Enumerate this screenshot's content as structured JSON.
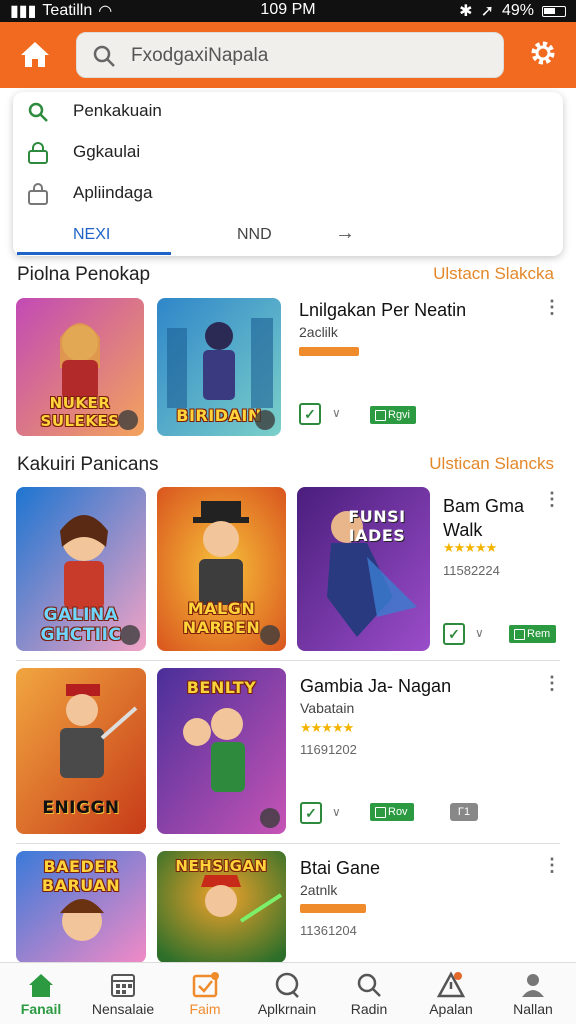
{
  "status_bar": {
    "carrier": "Teatilln",
    "time": "109 PM",
    "battery": "49%"
  },
  "search": {
    "value": "FxodgaxiNapala"
  },
  "dropdown": {
    "items": [
      {
        "label": "Penkakuain",
        "icon": "search-icon"
      },
      {
        "label": "Ggkaulai",
        "icon": "lock-icon"
      },
      {
        "label": "Apliindaga",
        "icon": "bag-icon"
      }
    ],
    "tabs": {
      "left": "NEXI",
      "middle": "NND",
      "arrow": "→"
    }
  },
  "section1": {
    "title": "Piolna Penokap",
    "link": "Ulstacn Slakcka",
    "app": {
      "title": "Lnilgakan Per Neatin",
      "subtitle": "2aclilk",
      "get": "Rgvi"
    },
    "thumbs": [
      {
        "caption": "NUKER SULEKES",
        "colors": [
          "#c24ab5",
          "#f3a35c"
        ]
      },
      {
        "caption": "BIRIDAIN",
        "colors": [
          "#2f86c9",
          "#7bd0c9"
        ]
      }
    ]
  },
  "section2": {
    "title": "Kakuiri Panicans",
    "link": "Ulstican Slancks",
    "apps": [
      {
        "title": "Bam Gma Walk",
        "title_l1": "Bam Gma",
        "title_l2": "Walk",
        "rating": "★★★★★",
        "number": "11582224",
        "get": "Rem",
        "thumbs": [
          {
            "caption": "GALINA GHCTIIC",
            "colors": [
              "#1d75d1",
              "#f2a3c5"
            ]
          },
          {
            "caption": "MALGN NARBEN",
            "colors": [
              "#d9561e",
              "#f7c13a"
            ]
          },
          {
            "caption": "FUNSI IADES",
            "colors": [
              "#4a1e7d",
              "#9b4dc9"
            ]
          }
        ]
      },
      {
        "title": "Gambia Ja- Nagan",
        "subtitle": "Vabatain",
        "rating": "★★★★★",
        "number": "11691202",
        "get": "Rov",
        "extra": "Γ1",
        "thumbs": [
          {
            "caption": "ENIGGN",
            "colors": [
              "#c73b18",
              "#f1a640"
            ]
          },
          {
            "caption": "BENLTY",
            "colors": [
              "#4a2f9a",
              "#c654b5"
            ]
          }
        ]
      },
      {
        "title": "Btai Gane",
        "subtitle": "2atnlk",
        "number": "11361204",
        "thumbs": [
          {
            "caption": "BAEDER BARUAN",
            "colors": [
              "#3a7ad9",
              "#f28ac6"
            ]
          },
          {
            "caption": "NEHSIGAN",
            "colors": [
              "#2d6f2a",
              "#f0a22b"
            ]
          }
        ]
      }
    ]
  },
  "bottom_nav": [
    {
      "label": "Fanail",
      "icon": "home-icon",
      "active": true
    },
    {
      "label": "Nensalaie",
      "icon": "calendar-icon"
    },
    {
      "label": "Faim",
      "icon": "check-box-icon",
      "highlight": true
    },
    {
      "label": "Aplkrnain",
      "icon": "chat-icon"
    },
    {
      "label": "Radin",
      "icon": "search-icon"
    },
    {
      "label": "Apalan",
      "icon": "alert-icon"
    },
    {
      "label": "Nallan",
      "icon": "person-icon"
    }
  ],
  "colors": {
    "accent": "#f26a1f",
    "green": "#2b9a41",
    "link": "#e3882a",
    "tab_active": "#1e63c6"
  }
}
